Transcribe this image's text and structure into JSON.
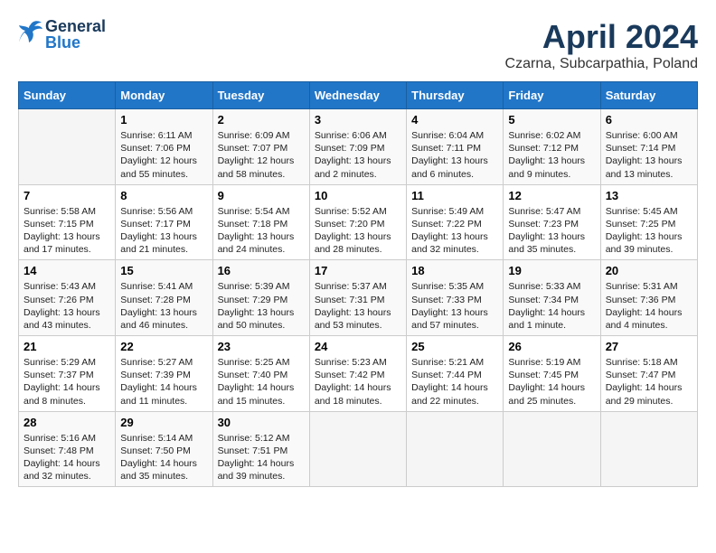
{
  "header": {
    "logo_general": "General",
    "logo_blue": "Blue",
    "main_title": "April 2024",
    "subtitle": "Czarna, Subcarpathia, Poland"
  },
  "days_of_week": [
    "Sunday",
    "Monday",
    "Tuesday",
    "Wednesday",
    "Thursday",
    "Friday",
    "Saturday"
  ],
  "weeks": [
    [
      {
        "num": "",
        "info": ""
      },
      {
        "num": "1",
        "info": "Sunrise: 6:11 AM\nSunset: 7:06 PM\nDaylight: 12 hours\nand 55 minutes."
      },
      {
        "num": "2",
        "info": "Sunrise: 6:09 AM\nSunset: 7:07 PM\nDaylight: 12 hours\nand 58 minutes."
      },
      {
        "num": "3",
        "info": "Sunrise: 6:06 AM\nSunset: 7:09 PM\nDaylight: 13 hours\nand 2 minutes."
      },
      {
        "num": "4",
        "info": "Sunrise: 6:04 AM\nSunset: 7:11 PM\nDaylight: 13 hours\nand 6 minutes."
      },
      {
        "num": "5",
        "info": "Sunrise: 6:02 AM\nSunset: 7:12 PM\nDaylight: 13 hours\nand 9 minutes."
      },
      {
        "num": "6",
        "info": "Sunrise: 6:00 AM\nSunset: 7:14 PM\nDaylight: 13 hours\nand 13 minutes."
      }
    ],
    [
      {
        "num": "7",
        "info": "Sunrise: 5:58 AM\nSunset: 7:15 PM\nDaylight: 13 hours\nand 17 minutes."
      },
      {
        "num": "8",
        "info": "Sunrise: 5:56 AM\nSunset: 7:17 PM\nDaylight: 13 hours\nand 21 minutes."
      },
      {
        "num": "9",
        "info": "Sunrise: 5:54 AM\nSunset: 7:18 PM\nDaylight: 13 hours\nand 24 minutes."
      },
      {
        "num": "10",
        "info": "Sunrise: 5:52 AM\nSunset: 7:20 PM\nDaylight: 13 hours\nand 28 minutes."
      },
      {
        "num": "11",
        "info": "Sunrise: 5:49 AM\nSunset: 7:22 PM\nDaylight: 13 hours\nand 32 minutes."
      },
      {
        "num": "12",
        "info": "Sunrise: 5:47 AM\nSunset: 7:23 PM\nDaylight: 13 hours\nand 35 minutes."
      },
      {
        "num": "13",
        "info": "Sunrise: 5:45 AM\nSunset: 7:25 PM\nDaylight: 13 hours\nand 39 minutes."
      }
    ],
    [
      {
        "num": "14",
        "info": "Sunrise: 5:43 AM\nSunset: 7:26 PM\nDaylight: 13 hours\nand 43 minutes."
      },
      {
        "num": "15",
        "info": "Sunrise: 5:41 AM\nSunset: 7:28 PM\nDaylight: 13 hours\nand 46 minutes."
      },
      {
        "num": "16",
        "info": "Sunrise: 5:39 AM\nSunset: 7:29 PM\nDaylight: 13 hours\nand 50 minutes."
      },
      {
        "num": "17",
        "info": "Sunrise: 5:37 AM\nSunset: 7:31 PM\nDaylight: 13 hours\nand 53 minutes."
      },
      {
        "num": "18",
        "info": "Sunrise: 5:35 AM\nSunset: 7:33 PM\nDaylight: 13 hours\nand 57 minutes."
      },
      {
        "num": "19",
        "info": "Sunrise: 5:33 AM\nSunset: 7:34 PM\nDaylight: 14 hours\nand 1 minute."
      },
      {
        "num": "20",
        "info": "Sunrise: 5:31 AM\nSunset: 7:36 PM\nDaylight: 14 hours\nand 4 minutes."
      }
    ],
    [
      {
        "num": "21",
        "info": "Sunrise: 5:29 AM\nSunset: 7:37 PM\nDaylight: 14 hours\nand 8 minutes."
      },
      {
        "num": "22",
        "info": "Sunrise: 5:27 AM\nSunset: 7:39 PM\nDaylight: 14 hours\nand 11 minutes."
      },
      {
        "num": "23",
        "info": "Sunrise: 5:25 AM\nSunset: 7:40 PM\nDaylight: 14 hours\nand 15 minutes."
      },
      {
        "num": "24",
        "info": "Sunrise: 5:23 AM\nSunset: 7:42 PM\nDaylight: 14 hours\nand 18 minutes."
      },
      {
        "num": "25",
        "info": "Sunrise: 5:21 AM\nSunset: 7:44 PM\nDaylight: 14 hours\nand 22 minutes."
      },
      {
        "num": "26",
        "info": "Sunrise: 5:19 AM\nSunset: 7:45 PM\nDaylight: 14 hours\nand 25 minutes."
      },
      {
        "num": "27",
        "info": "Sunrise: 5:18 AM\nSunset: 7:47 PM\nDaylight: 14 hours\nand 29 minutes."
      }
    ],
    [
      {
        "num": "28",
        "info": "Sunrise: 5:16 AM\nSunset: 7:48 PM\nDaylight: 14 hours\nand 32 minutes."
      },
      {
        "num": "29",
        "info": "Sunrise: 5:14 AM\nSunset: 7:50 PM\nDaylight: 14 hours\nand 35 minutes."
      },
      {
        "num": "30",
        "info": "Sunrise: 5:12 AM\nSunset: 7:51 PM\nDaylight: 14 hours\nand 39 minutes."
      },
      {
        "num": "",
        "info": ""
      },
      {
        "num": "",
        "info": ""
      },
      {
        "num": "",
        "info": ""
      },
      {
        "num": "",
        "info": ""
      }
    ]
  ]
}
